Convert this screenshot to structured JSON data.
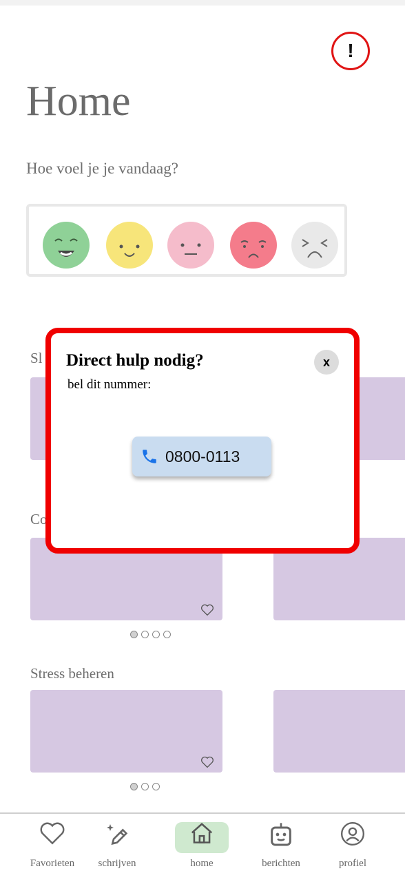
{
  "header": {
    "title": "Home",
    "alert_symbol": "!"
  },
  "mood": {
    "question": "Hoe voel je je vandaag?",
    "faces": [
      {
        "name": "very-happy",
        "color": "#8fd197"
      },
      {
        "name": "happy",
        "color": "#f7e57a"
      },
      {
        "name": "neutral",
        "color": "#f5bccb"
      },
      {
        "name": "sad",
        "color": "#f47c8b"
      },
      {
        "name": "very-sad",
        "color": "#e9e9e9"
      }
    ]
  },
  "sections": {
    "first_label_partial": "Sl",
    "second_label_partial": "Co",
    "stress_label": "Stress beheren"
  },
  "modal": {
    "title": "Direct hulp nodig?",
    "subtitle": "bel dit nummer:",
    "close_label": "x",
    "phone": "0800-0113"
  },
  "nav": {
    "items": [
      {
        "label": "Favorieten",
        "icon": "heart-icon"
      },
      {
        "label": "schrijven",
        "icon": "pencil-sparkle-icon"
      },
      {
        "label": "home",
        "icon": "home-icon"
      },
      {
        "label": "berichten",
        "icon": "robot-icon"
      },
      {
        "label": "profiel",
        "icon": "user-circle-icon"
      }
    ]
  },
  "colors": {
    "accent_red": "#f00000",
    "card_purple": "#d6c8e2",
    "nav_active": "#cfe9cf",
    "call_button": "#c9dcf0"
  }
}
